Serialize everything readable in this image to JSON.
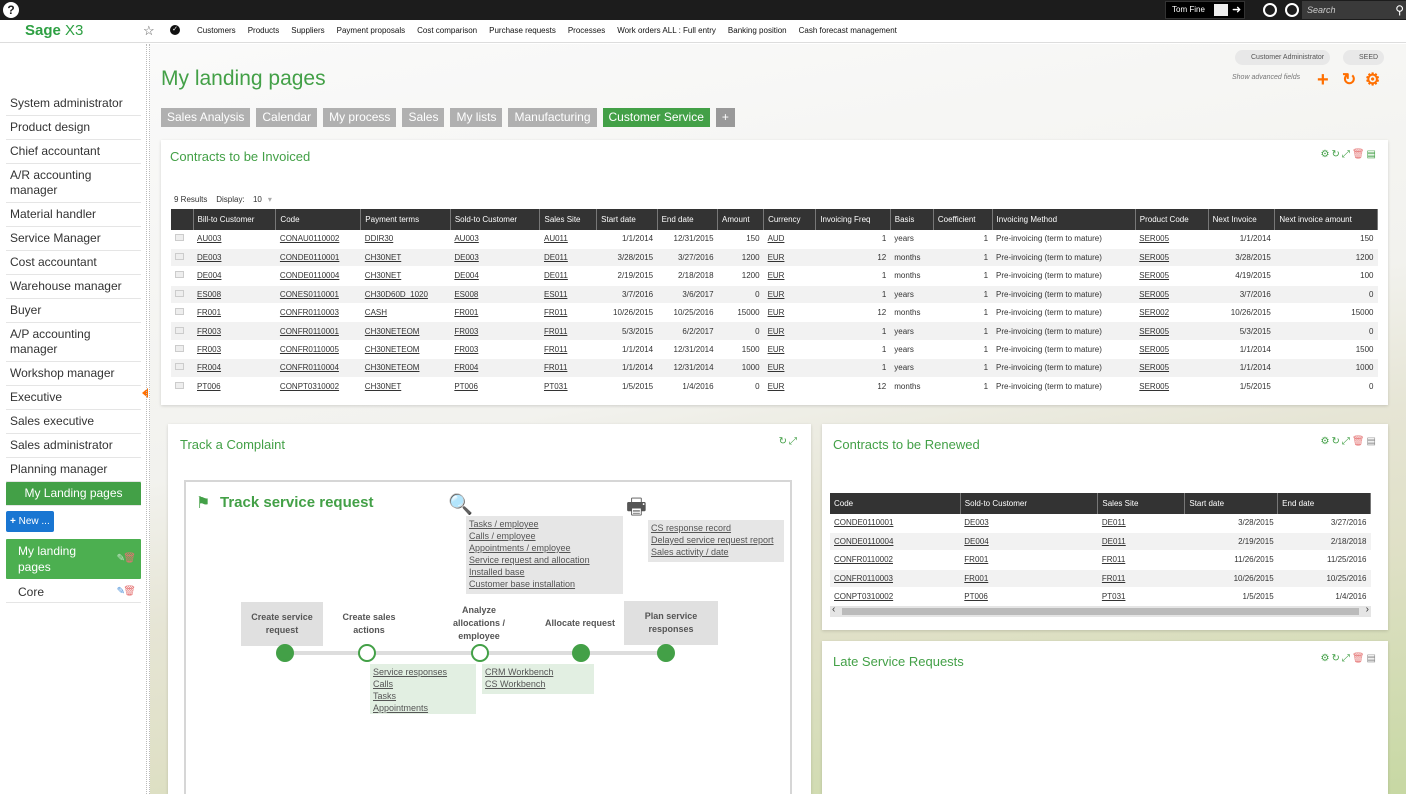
{
  "topbar": {
    "help": "?",
    "user": "Tom Fine",
    "search_placeholder": "Search"
  },
  "nav": {
    "brand_main": "Sage",
    "brand_sub": " X3",
    "links": [
      "Customers",
      "Products",
      "Suppliers",
      "Payment proposals",
      "Cost comparison",
      "Purchase requests",
      "Processes",
      "Work orders ALL : Full entry",
      "Banking position",
      "Cash forecast management"
    ]
  },
  "sidebar": {
    "roles": [
      "System administrator",
      "Product design",
      "Chief accountant",
      "A/R accounting manager",
      "Material handler",
      "Service Manager",
      "Cost accountant",
      "Warehouse manager",
      "Buyer",
      "A/P accounting manager",
      "Workshop manager",
      "Executive",
      "Sales executive",
      "Sales administrator",
      "Planning manager",
      "My Landing pages"
    ],
    "new_button": "New ...",
    "pages": [
      {
        "label": "My landing pages"
      },
      {
        "label": "Core"
      }
    ]
  },
  "header": {
    "title": "My landing pages",
    "customer_admin": "Customer Administrator",
    "seed": "SEED",
    "show_advanced": "Show advanced fields"
  },
  "tabs": [
    "Sales Analysis",
    "Calendar",
    "My process",
    "Sales",
    "My lists",
    "Manufacturing",
    "Customer Service",
    "+"
  ],
  "invoiced": {
    "title": "Contracts to be Invoiced",
    "results": "9 Results",
    "display_label": "Display:",
    "display_value": "10",
    "columns": [
      "Bill-to Customer",
      "Code",
      "Payment terms",
      "Sold-to Customer",
      "Sales Site",
      "Start date",
      "End date",
      "Amount",
      "Currency",
      "Invoicing Freq",
      "Basis",
      "Coefficient",
      "Invoicing Method",
      "Product Code",
      "Next Invoice",
      "Next invoice amount"
    ],
    "rows": [
      [
        "AU003",
        "CONAU0110002",
        "DDIR30",
        "AU003",
        "AU011",
        "1/1/2014",
        "12/31/2015",
        "150",
        "AUD",
        "1",
        "years",
        "1",
        "Pre-invoicing (term to mature)",
        "SER005",
        "1/1/2014",
        "150"
      ],
      [
        "DE003",
        "CONDE0110001",
        "CH30NET",
        "DE003",
        "DE011",
        "3/28/2015",
        "3/27/2016",
        "1200",
        "EUR",
        "12",
        "months",
        "1",
        "Pre-invoicing (term to mature)",
        "SER005",
        "3/28/2015",
        "1200"
      ],
      [
        "DE004",
        "CONDE0110004",
        "CH30NET",
        "DE004",
        "DE011",
        "2/19/2015",
        "2/18/2018",
        "1200",
        "EUR",
        "1",
        "months",
        "1",
        "Pre-invoicing (term to mature)",
        "SER005",
        "4/19/2015",
        "100"
      ],
      [
        "ES008",
        "CONES0110001",
        "CH30D60D_1020",
        "ES008",
        "ES011",
        "3/7/2016",
        "3/6/2017",
        "0",
        "EUR",
        "1",
        "years",
        "1",
        "Pre-invoicing (term to mature)",
        "SER005",
        "3/7/2016",
        "0"
      ],
      [
        "FR001",
        "CONFR0110003",
        "CASH",
        "FR001",
        "FR011",
        "10/26/2015",
        "10/25/2016",
        "15000",
        "EUR",
        "12",
        "months",
        "1",
        "Pre-invoicing (term to mature)",
        "SER002",
        "10/26/2015",
        "15000"
      ],
      [
        "FR003",
        "CONFR0110001",
        "CH30NETEOM",
        "FR003",
        "FR011",
        "5/3/2015",
        "6/2/2017",
        "0",
        "EUR",
        "1",
        "years",
        "1",
        "Pre-invoicing (term to mature)",
        "SER005",
        "5/3/2015",
        "0"
      ],
      [
        "FR003",
        "CONFR0110005",
        "CH30NETEOM",
        "FR003",
        "FR011",
        "1/1/2014",
        "12/31/2014",
        "1500",
        "EUR",
        "1",
        "years",
        "1",
        "Pre-invoicing (term to mature)",
        "SER005",
        "1/1/2014",
        "1500"
      ],
      [
        "FR004",
        "CONFR0110004",
        "CH30NETEOM",
        "FR004",
        "FR011",
        "1/1/2014",
        "12/31/2014",
        "1000",
        "EUR",
        "1",
        "years",
        "1",
        "Pre-invoicing (term to mature)",
        "SER005",
        "1/1/2014",
        "1000"
      ],
      [
        "PT006",
        "CONPT0310002",
        "CH30NET",
        "PT006",
        "PT031",
        "1/5/2015",
        "1/4/2016",
        "0",
        "EUR",
        "12",
        "months",
        "1",
        "Pre-invoicing (term to mature)",
        "SER005",
        "1/5/2015",
        "0"
      ]
    ]
  },
  "complaint": {
    "title": "Track a Complaint",
    "heading": "Track service request",
    "search_links": [
      "Tasks / employee",
      "Calls / employee",
      "Appointments / employee",
      "Service request and allocation",
      "Installed base",
      "Customer base installation"
    ],
    "print_links": [
      "CS response record",
      "Delayed service request report",
      "Sales activity / date"
    ],
    "steps": [
      "Create service request",
      "Create sales actions",
      "Analyze allocations / employee",
      "Allocate request",
      "Plan service responses"
    ],
    "step2_links": [
      "Service responses",
      "Calls",
      "Tasks",
      "Appointments"
    ],
    "step3_links": [
      "CRM Workbench",
      "CS Workbench"
    ]
  },
  "renewed": {
    "title": "Contracts to be Renewed",
    "columns": [
      "Code",
      "Sold-to Customer",
      "Sales Site",
      "Start date",
      "End date"
    ],
    "rows": [
      [
        "CONDE0110001",
        "DE003",
        "DE011",
        "3/28/2015",
        "3/27/2016"
      ],
      [
        "CONDE0110004",
        "DE004",
        "DE011",
        "2/19/2015",
        "2/18/2018"
      ],
      [
        "CONFR0110002",
        "FR001",
        "FR011",
        "11/26/2015",
        "11/25/2016"
      ],
      [
        "CONFR0110003",
        "FR001",
        "FR011",
        "10/26/2015",
        "10/25/2016"
      ],
      [
        "CONPT0310002",
        "PT006",
        "PT031",
        "1/5/2015",
        "1/4/2016"
      ]
    ]
  },
  "late": {
    "title": "Late Service Requests"
  }
}
